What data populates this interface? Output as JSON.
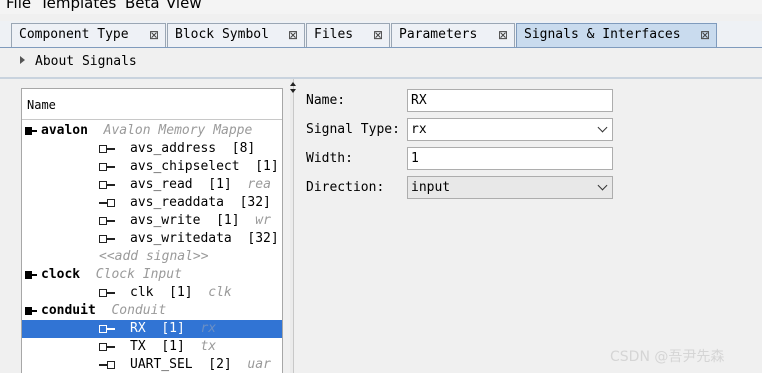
{
  "menu": [
    "File",
    "Templates",
    "Beta",
    "View"
  ],
  "tabs": [
    {
      "label": "Component Type",
      "close": "⊠",
      "active": false
    },
    {
      "label": "Block Symbol",
      "close": "⊠",
      "active": false
    },
    {
      "label": "Files",
      "close": "⊠",
      "active": false
    },
    {
      "label": "Parameters",
      "close": "⊠",
      "active": false
    },
    {
      "label": "Signals & Interfaces",
      "close": "⊠",
      "active": true
    }
  ],
  "about_label": "About Signals",
  "tree": {
    "header": "Name",
    "rows": [
      {
        "kind": "group",
        "name": "avalon",
        "detail": "Avalon Memory Mappe"
      },
      {
        "kind": "signal",
        "icon": "in",
        "name": "avs_address",
        "width": "[8]",
        "role": ""
      },
      {
        "kind": "signal",
        "icon": "in",
        "name": "avs_chipselect",
        "width": "[1]",
        "role": ""
      },
      {
        "kind": "signal",
        "icon": "in",
        "name": "avs_read",
        "width": "[1]",
        "role": "rea"
      },
      {
        "kind": "signal",
        "icon": "out",
        "name": "avs_readdata",
        "width": "[32]",
        "role": ""
      },
      {
        "kind": "signal",
        "icon": "in",
        "name": "avs_write",
        "width": "[1]",
        "role": "wr"
      },
      {
        "kind": "signal",
        "icon": "in",
        "name": "avs_writedata",
        "width": "[32]",
        "role": ""
      },
      {
        "kind": "add",
        "name": "<<add signal>>"
      },
      {
        "kind": "group",
        "name": "clock",
        "detail": "Clock Input"
      },
      {
        "kind": "signal",
        "icon": "in",
        "name": "clk",
        "width": "[1]",
        "role": "clk"
      },
      {
        "kind": "group",
        "name": "conduit",
        "detail": "Conduit"
      },
      {
        "kind": "signal",
        "icon": "in",
        "name": "RX",
        "width": "[1]",
        "role": "rx",
        "selected": true
      },
      {
        "kind": "signal",
        "icon": "in",
        "name": "TX",
        "width": "[1]",
        "role": "tx"
      },
      {
        "kind": "signal",
        "icon": "out",
        "name": "UART_SEL",
        "width": "[2]",
        "role": "uar"
      }
    ]
  },
  "props": {
    "name_label": "Name:",
    "name_value": "RX",
    "signal_type_label": "Signal Type:",
    "signal_type_value": "rx",
    "width_label": "Width:",
    "width_value": "1",
    "direction_label": "Direction:",
    "direction_value": "input"
  },
  "watermark": "CSDN @吾尹先森"
}
